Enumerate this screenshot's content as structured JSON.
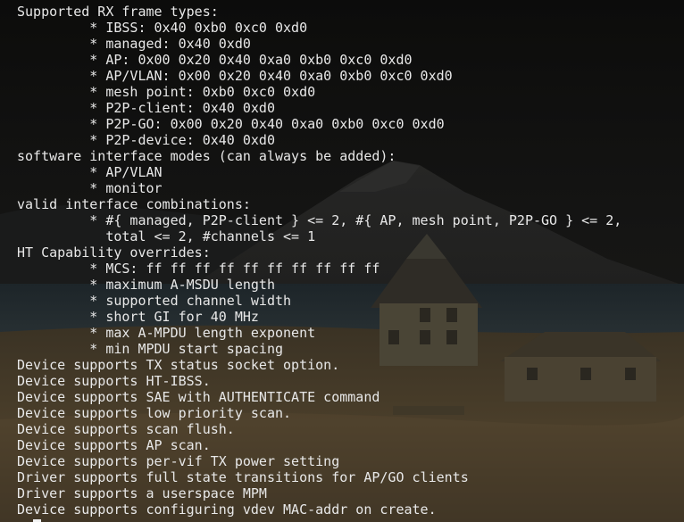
{
  "terminal": {
    "lines": [
      "Supported RX frame types:",
      "         * IBSS: 0x40 0xb0 0xc0 0xd0",
      "         * managed: 0x40 0xd0",
      "         * AP: 0x00 0x20 0x40 0xa0 0xb0 0xc0 0xd0",
      "         * AP/VLAN: 0x00 0x20 0x40 0xa0 0xb0 0xc0 0xd0",
      "         * mesh point: 0xb0 0xc0 0xd0",
      "         * P2P-client: 0x40 0xd0",
      "         * P2P-GO: 0x00 0x20 0x40 0xa0 0xb0 0xc0 0xd0",
      "         * P2P-device: 0x40 0xd0",
      "software interface modes (can always be added):",
      "         * AP/VLAN",
      "         * monitor",
      "valid interface combinations:",
      "         * #{ managed, P2P-client } <= 2, #{ AP, mesh point, P2P-GO } <= 2,",
      "           total <= 2, #channels <= 1",
      "HT Capability overrides:",
      "         * MCS: ff ff ff ff ff ff ff ff ff ff",
      "         * maximum A-MSDU length",
      "         * supported channel width",
      "         * short GI for 40 MHz",
      "         * max A-MPDU length exponent",
      "         * min MPDU start spacing",
      "Device supports TX status socket option.",
      "Device supports HT-IBSS.",
      "Device supports SAE with AUTHENTICATE command",
      "Device supports low priority scan.",
      "Device supports scan flush.",
      "Device supports AP scan.",
      "Device supports per-vif TX power setting",
      "Driver supports full state transitions for AP/GO clients",
      "Driver supports a userspace MPM",
      "Device supports configuring vdev MAC-addr on create."
    ],
    "prompt": "> "
  },
  "colors": {
    "text": "#e8e8e8",
    "cursor": "#f2f2f2",
    "background": "#0d0d0c"
  }
}
